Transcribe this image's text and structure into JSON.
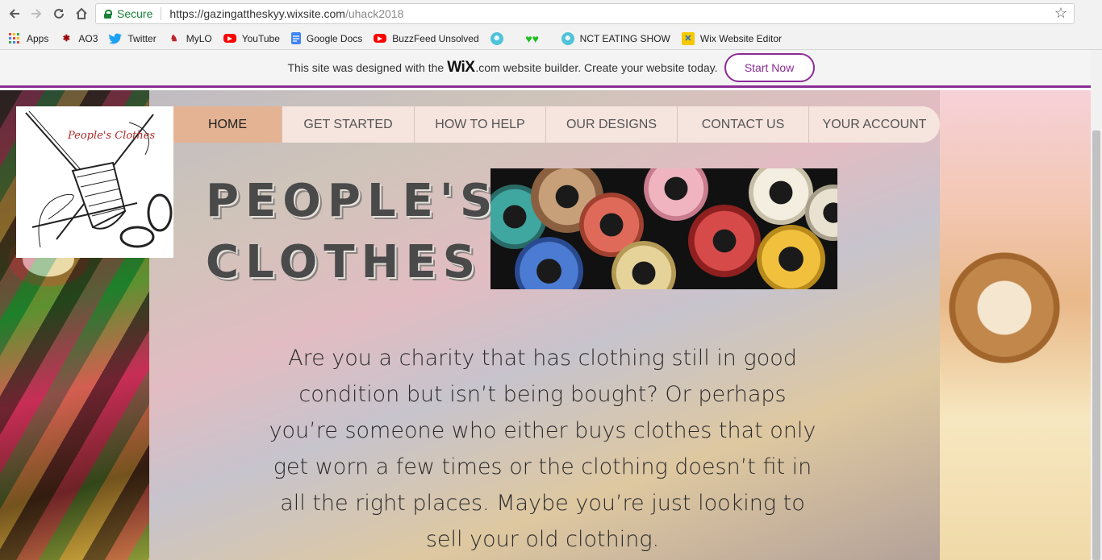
{
  "browser": {
    "secure_label": "Secure",
    "url_host": "https://gazingattheskyy.wixsite.com",
    "url_path": "/uhack2018",
    "bookmarks": [
      {
        "label": "Apps",
        "icon": "apps-grid-icon",
        "color": "#e94235"
      },
      {
        "label": "AO3",
        "icon": "ao3-icon",
        "color": "#990000"
      },
      {
        "label": "Twitter",
        "icon": "twitter-icon",
        "color": "#1da1f2"
      },
      {
        "label": "MyLO",
        "icon": "mylo-icon",
        "color": "#c0262d"
      },
      {
        "label": "YouTube",
        "icon": "youtube-icon",
        "color": "#ff0000"
      },
      {
        "label": "Google Docs",
        "icon": "google-docs-icon",
        "color": "#4285f4"
      },
      {
        "label": "BuzzFeed Unsolved",
        "icon": "youtube-icon",
        "color": "#ff0000"
      },
      {
        "label": "",
        "icon": "bookmark-icon",
        "color": "#4fc3d9"
      },
      {
        "label": "",
        "icon": "green-hearts-icon",
        "color": "#1fbf1f"
      },
      {
        "label": "NCT EATING SHOW",
        "icon": "bookmark-icon",
        "color": "#4fc3d9"
      },
      {
        "label": "Wix Website Editor",
        "icon": "wix-editor-icon",
        "color": "#f5c800"
      }
    ]
  },
  "wix_banner": {
    "prefix": "This site was designed with the",
    "brand": "WiX",
    "suffix": ".com website builder. Create your website today.",
    "cta": "Start Now",
    "accent": "#8b2c94"
  },
  "site": {
    "logo_text": "People's Clothes",
    "nav": [
      {
        "label": "HOME",
        "active": true
      },
      {
        "label": "GET STARTED",
        "active": false
      },
      {
        "label": "HOW TO HELP",
        "active": false
      },
      {
        "label": "OUR DESIGNS",
        "active": false
      },
      {
        "label": "CONTACT US",
        "active": false
      },
      {
        "label": "YOUR ACCOUNT",
        "active": false
      }
    ],
    "title_line1": "PEOPLE'S",
    "title_line2": "CLOTHES",
    "intro": "Are you a charity that has clothing still in good condition but isn’t being bought? Or perhaps you’re someone who either buys clothes that only get worn a few times or the clothing doesn’t fit in all the right places. Maybe you’re just looking to sell your old clothing."
  }
}
